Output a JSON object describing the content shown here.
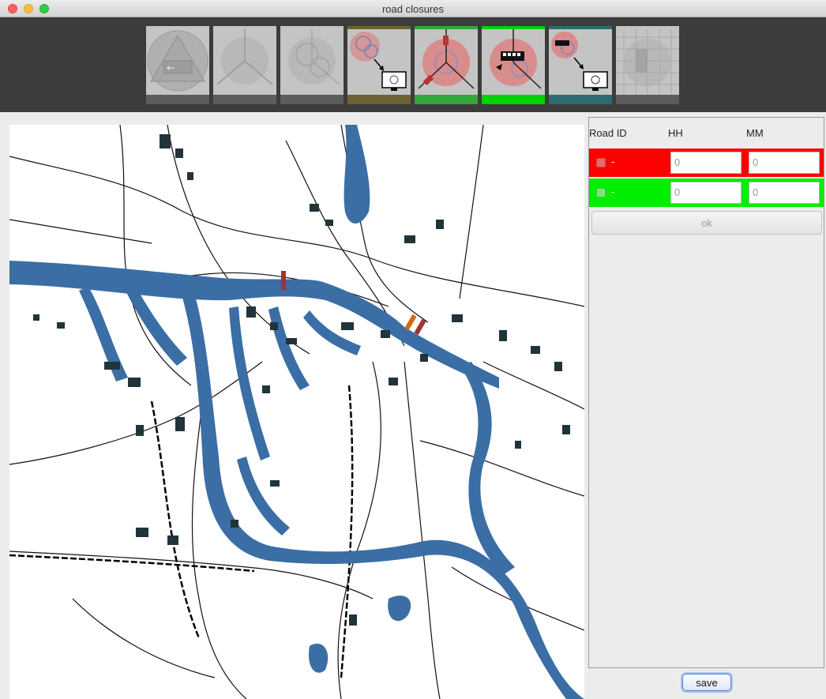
{
  "window": {
    "title": "road closures"
  },
  "toolbar": {
    "tools": [
      {
        "name": "evacuation-exit",
        "icon": "emergency-exit-icon",
        "state": "disabled",
        "bar_color": "#5c5c5c"
      },
      {
        "name": "road-network",
        "icon": "three-roads-icon",
        "state": "disabled",
        "bar_color": "#5c5c5c"
      },
      {
        "name": "circle-overlap",
        "icon": "circles-icon",
        "state": "disabled",
        "bar_color": "#5c5c5c"
      },
      {
        "name": "circles-to-monitor",
        "icon": "circles-to-monitor-icon",
        "state": "enabled",
        "bar_color": "#6b6331"
      },
      {
        "name": "road-closures",
        "icon": "closed-roads-icon",
        "state": "enabled",
        "bar_color": "#33a63c"
      },
      {
        "name": "bus-routing",
        "icon": "bus-icon",
        "state": "selected",
        "bar_color": "#00d200"
      },
      {
        "name": "bus-to-monitor",
        "icon": "bus-to-monitor-icon",
        "state": "enabled",
        "bar_color": "#2e6a72"
      },
      {
        "name": "grid-analysis",
        "icon": "grid-icon",
        "state": "disabled",
        "bar_color": "#5c5c5c"
      }
    ]
  },
  "table": {
    "columns": [
      "Road ID",
      "HH",
      "MM"
    ],
    "rows": [
      {
        "road_id": "-",
        "hh": "0",
        "mm": "0",
        "color": "#ff0000"
      },
      {
        "road_id": "-",
        "hh": "0",
        "mm": "0",
        "color": "#00ee00"
      }
    ],
    "ok_label": "ok"
  },
  "footer": {
    "save_label": "save"
  },
  "colors": {
    "water": "#3a6ea5",
    "closure_red": "#a23232",
    "closure_orange": "#d06a1a"
  }
}
